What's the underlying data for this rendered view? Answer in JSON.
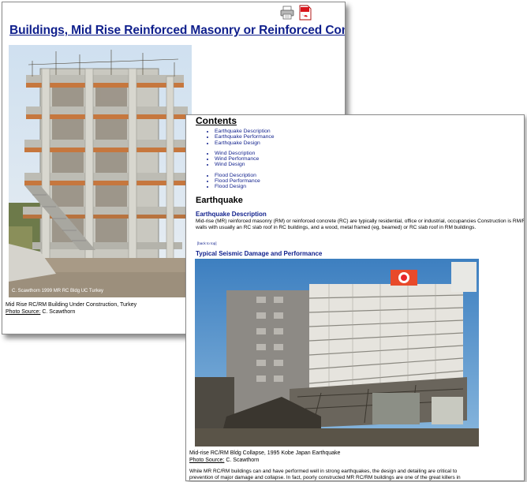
{
  "back_page": {
    "title": "Buildings, Mid Rise Reinforced Masonry or Reinforced Concrete",
    "photo_stamp": "C. Scawthorn 1999 MR RC Bldg UC Turkey",
    "caption": "Mid Rise RC/RM Building Under Construction, Turkey",
    "photo_source_label": "Photo Source:",
    "photo_source_name": "C. Scawthorn",
    "icons": [
      "printer-icon",
      "pdf-icon"
    ]
  },
  "front_page": {
    "contents_heading": "Contents",
    "toc": [
      [
        "Earthquake Description",
        "Earthquake Performance",
        "Earthquake Design"
      ],
      [
        "Wind Description",
        "Wind Performance",
        "Wind Design"
      ],
      [
        "Flood Description",
        "Flood Performance",
        "Flood Design"
      ]
    ],
    "earthquake_heading": "Earthquake",
    "earthquake_description_heading": "Earthquake Description",
    "earthquake_description_text": "Mid-rise (MR) reinforced masonry (RM) or reinforced concrete (RC) are typically residential, office or industrial, occupancies Construction is RM/RC walls with usually an RC slab roof in RC buildings, and a wood, metal framed (eg, beamed) or RC slab roof in RM buildings.",
    "back_to_top": "[back to top]",
    "seismic_heading": "Typical Seismic Damage and Performance",
    "caption": "Mid-rise RC/RM Bldg Collapse, 1995 Kobe Japan Earthquake",
    "photo_source_label": "Photo Source:",
    "photo_source_name": "C. Scawthorn",
    "final_text_line1": "While MR RC/RM buildings can and have performed well in strong earthquakes, the design and detailing are critical to",
    "final_text_line2": "prevention of major damage and collapse. In fact, poorly constructed MR RC/RM buildings are one of the great killers in"
  },
  "colors": {
    "link": "#0f1f8c",
    "border": "#8a8a8a"
  }
}
